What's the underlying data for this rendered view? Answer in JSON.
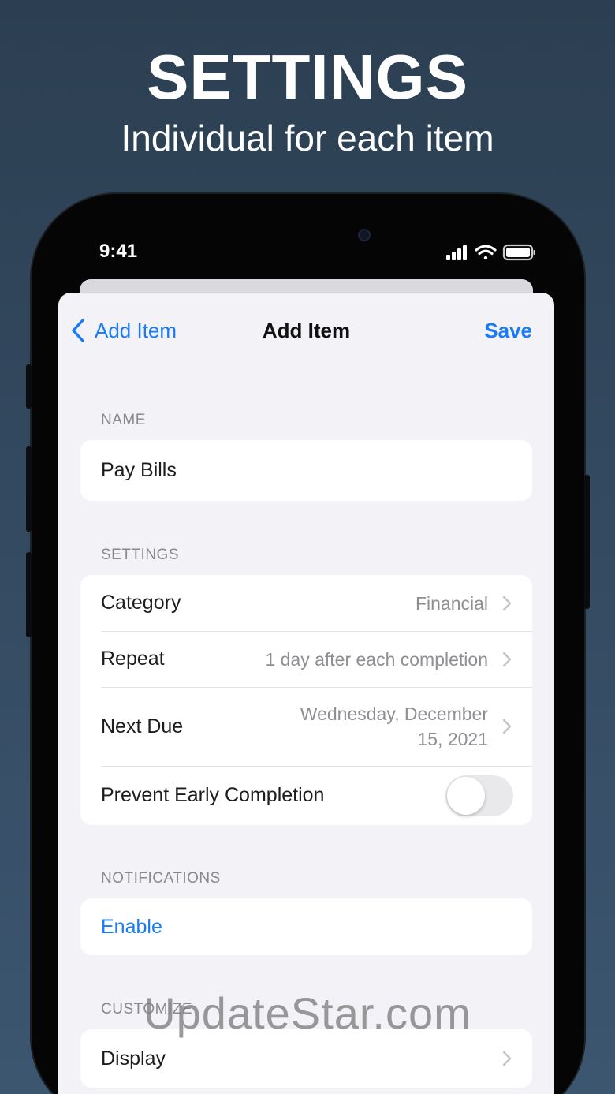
{
  "promo": {
    "title": "SETTINGS",
    "subtitle": "Individual for each item"
  },
  "status_bar": {
    "time": "9:41",
    "icons": [
      "cellular-signal-icon",
      "wifi-icon",
      "battery-icon"
    ]
  },
  "nav": {
    "back_label": "Add Item",
    "title": "Add Item",
    "save_label": "Save"
  },
  "sections": {
    "name": {
      "header": "NAME",
      "value": "Pay Bills"
    },
    "settings": {
      "header": "SETTINGS",
      "rows": [
        {
          "label": "Category",
          "value": "Financial"
        },
        {
          "label": "Repeat",
          "value": "1 day after each completion"
        },
        {
          "label": "Next Due",
          "value_line1": "Wednesday, December",
          "value_line2": "15, 2021"
        },
        {
          "label": "Prevent Early Completion",
          "toggle_on": false
        }
      ]
    },
    "notifications": {
      "header": "NOTIFICATIONS",
      "enable_label": "Enable"
    },
    "customize": {
      "header": "CUSTOMIZE",
      "display_label": "Display"
    }
  },
  "watermark": "UpdateStar.com",
  "colors": {
    "accent": "#1a7cf5",
    "background_top": "#2c3f52",
    "background_bottom": "#3c5670",
    "sheet": "#f2f2f7"
  }
}
